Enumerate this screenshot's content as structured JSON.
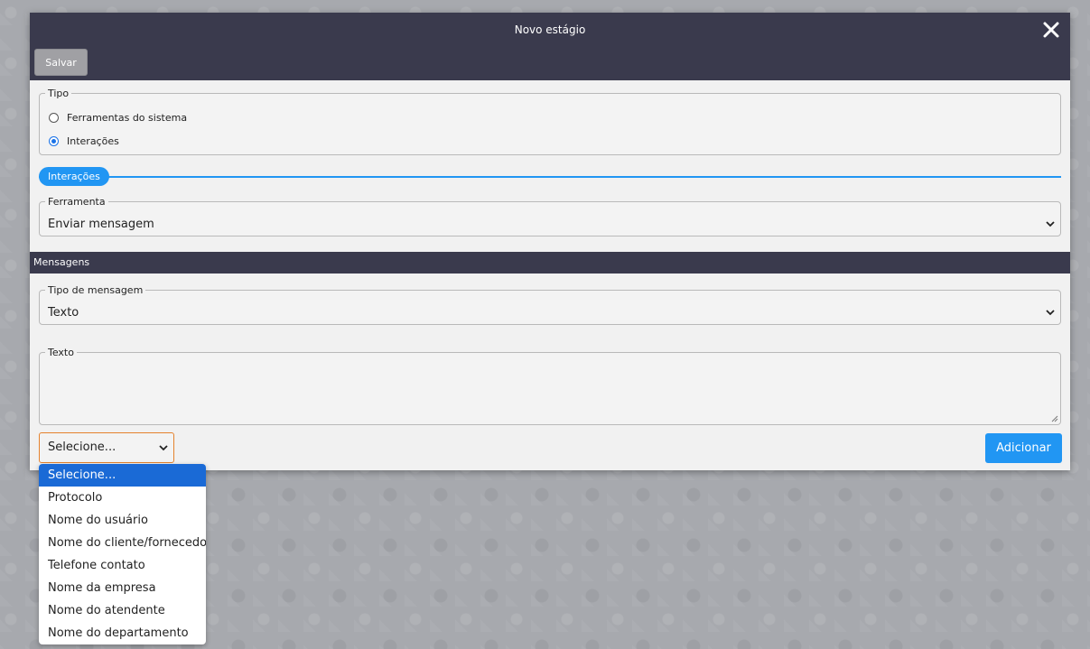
{
  "modal": {
    "title": "Novo estágio",
    "save_label": "Salvar"
  },
  "tipo": {
    "legend": "Tipo",
    "options": [
      {
        "label": "Ferramentas do sistema",
        "checked": false
      },
      {
        "label": "Interações",
        "checked": true
      }
    ]
  },
  "interacoes_tag": "Interações",
  "ferramenta": {
    "legend": "Ferramenta",
    "value": "Enviar mensagem"
  },
  "mensagens": {
    "section_title": "Mensagens",
    "tipo_mensagem": {
      "legend": "Tipo de mensagem",
      "value": "Texto"
    },
    "texto": {
      "legend": "Texto",
      "value": ""
    }
  },
  "variables": {
    "selected": "Selecione...",
    "add_label": "Adicionar",
    "options": [
      "Selecione...",
      "Protocolo",
      "Nome do usuário",
      "Nome do cliente/fornecedor",
      "Telefone contato",
      "Nome da empresa",
      "Nome do atendente",
      "Nome do departamento"
    ]
  },
  "colors": {
    "header": "#3a3a4d",
    "accent": "#2196f3",
    "focus_border": "#e5822d",
    "selected_option": "#1a6ad6"
  }
}
